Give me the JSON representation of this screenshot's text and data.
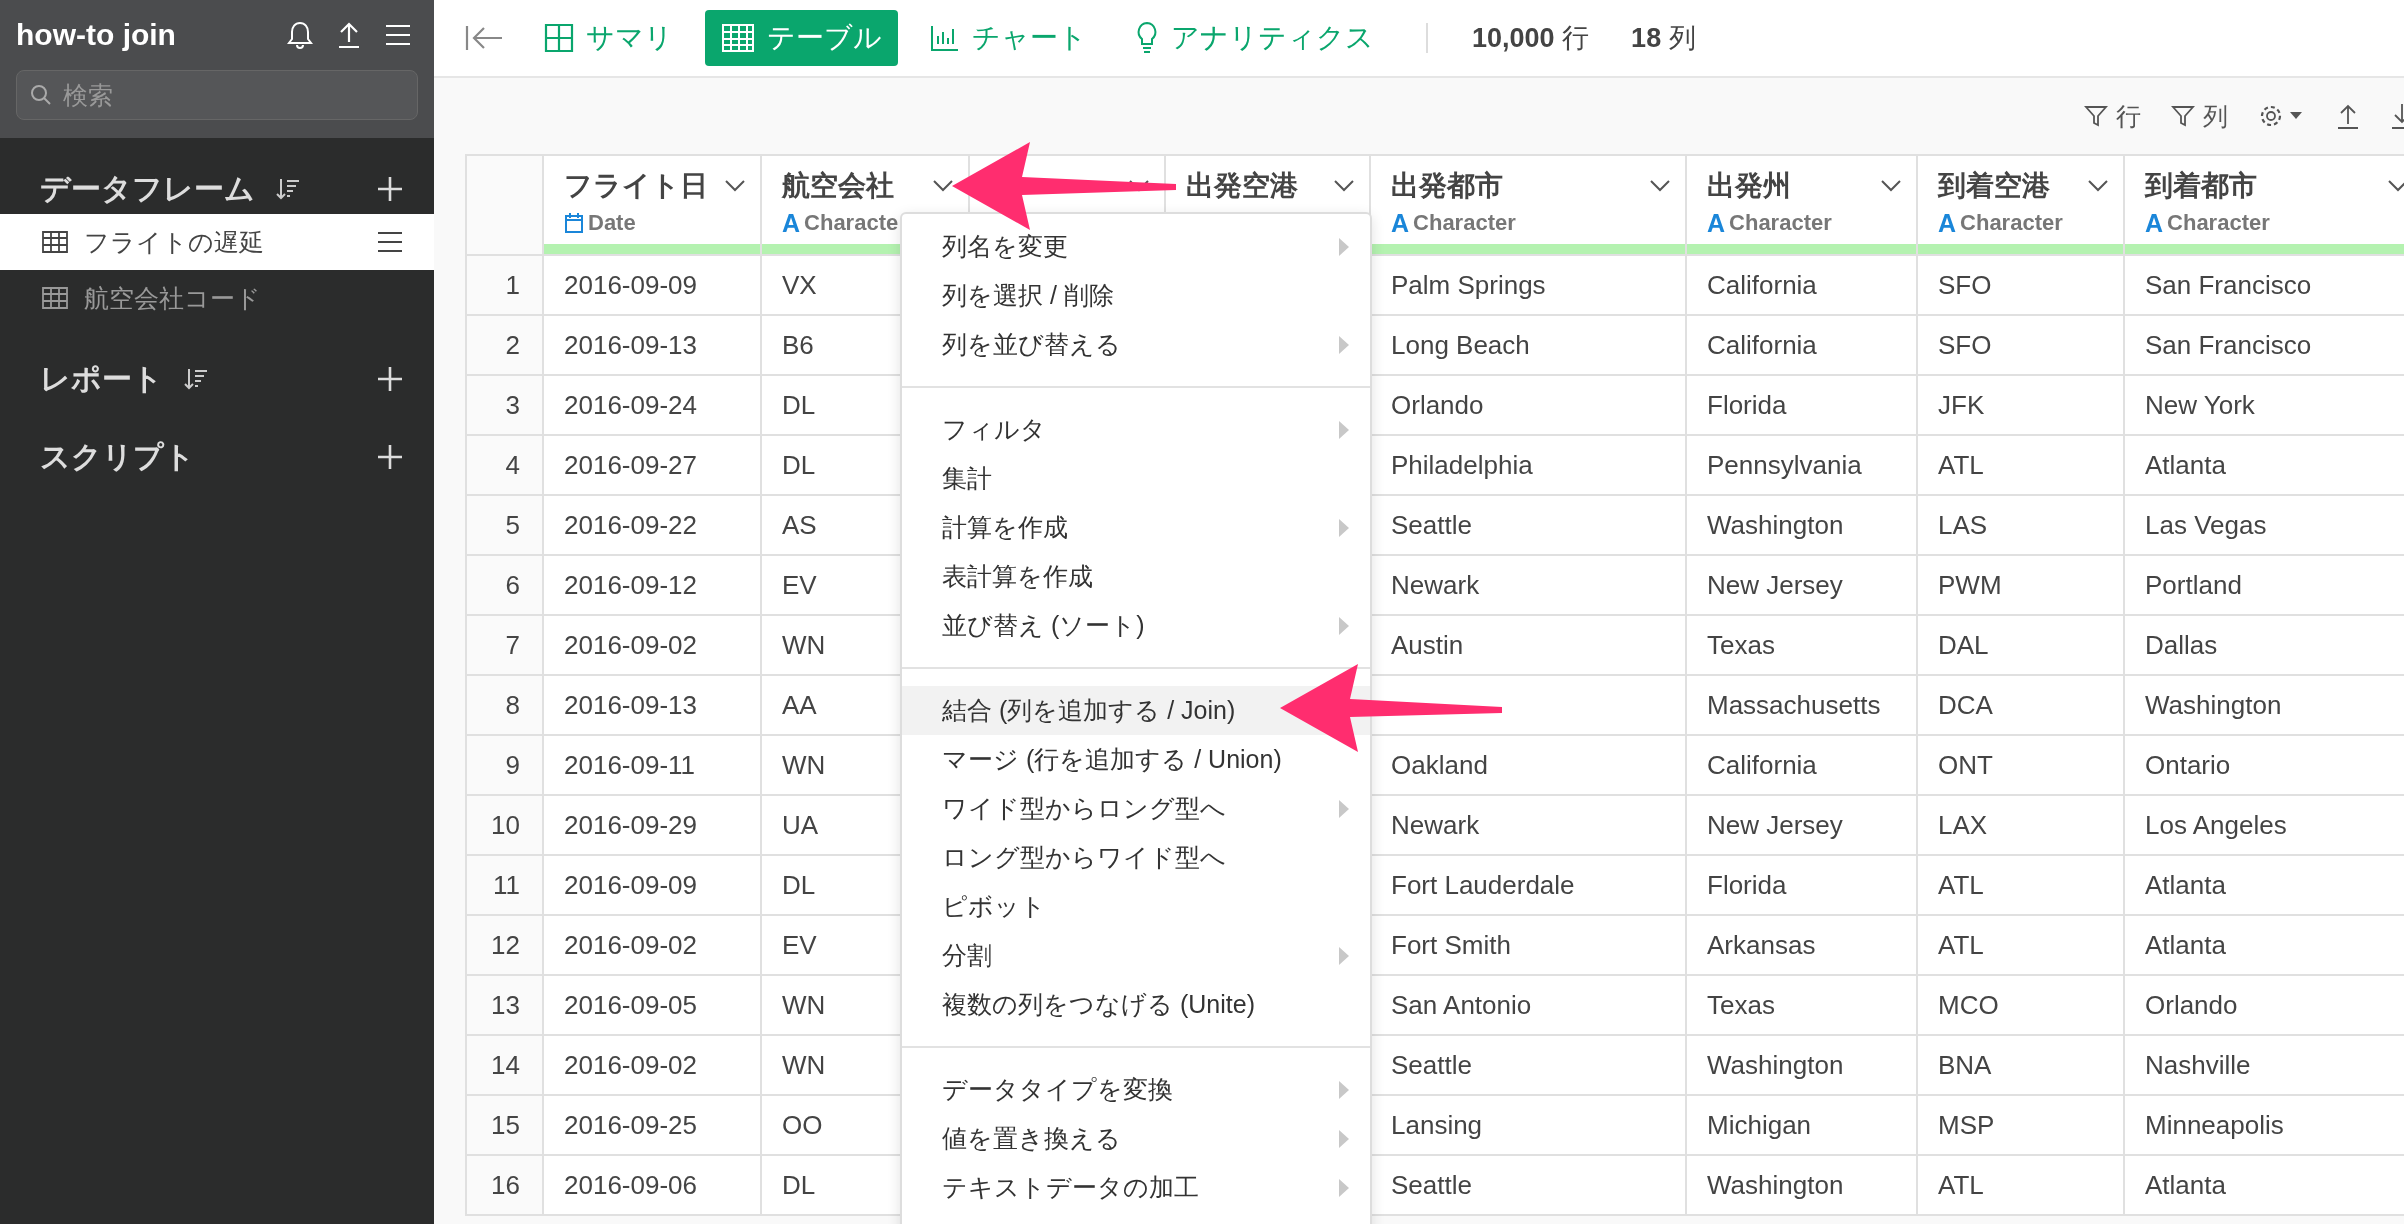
{
  "sidebar": {
    "title": "how-to join",
    "search": {
      "placeholder": "検索"
    },
    "sections": [
      {
        "title": "データフレーム",
        "sortable": true,
        "items": [
          {
            "label": "フライトの遅延",
            "selected": true
          },
          {
            "label": "航空会社コード",
            "selected": false
          }
        ]
      },
      {
        "title": "レポート",
        "sortable": true
      },
      {
        "title": "スクリプト",
        "sortable": false
      }
    ]
  },
  "tabs": [
    {
      "label": "サマリ",
      "kind": "summary",
      "selected": false
    },
    {
      "label": "テーブル",
      "kind": "table",
      "selected": true
    },
    {
      "label": "チャート",
      "kind": "chart",
      "selected": false
    },
    {
      "label": "アナリティクス",
      "kind": "analytics",
      "selected": false
    }
  ],
  "counts": [
    "**10,000** 行",
    "**18** 列"
  ],
  "toolbar": [
    {
      "kind": "filter",
      "label": "行"
    },
    {
      "kind": "filter",
      "label": "列"
    },
    {
      "kind": "settings"
    },
    {
      "kind": "upload"
    },
    {
      "kind": "download"
    }
  ],
  "table": {
    "columns": [
      {
        "name": "フライト日",
        "type": {
          "kind": "date",
          "label": "Date"
        }
      },
      {
        "name": "航空会社",
        "type": {
          "kind": "character",
          "icon": "A",
          "label": "Characte"
        }
      },
      {
        "caret": true
      },
      {
        "name": "出発空港"
      },
      {
        "name": "出発都市",
        "type": {
          "kind": "character",
          "icon": "A",
          "label": "Character"
        }
      },
      {
        "name": "出発州",
        "type": {
          "kind": "character",
          "icon": "A",
          "label": "Character"
        }
      },
      {
        "name": "到着空港",
        "type": {
          "kind": "character",
          "icon": "A",
          "label": "Character"
        }
      },
      {
        "name": "到着都市",
        "type": {
          "kind": "character",
          "icon": "A",
          "label": "Character"
        }
      }
    ],
    "rows": [
      {
        "num": "1",
        "cells": [
          "2016-09-09",
          "VX",
          null,
          null,
          "Palm Springs",
          "California",
          "SFO",
          "San Francisco"
        ]
      },
      {
        "num": "2",
        "cells": [
          "2016-09-13",
          "B6",
          null,
          null,
          "Long Beach",
          "California",
          "SFO",
          "San Francisco"
        ]
      },
      {
        "num": "3",
        "cells": [
          "2016-09-24",
          "DL",
          null,
          null,
          "Orlando",
          "Florida",
          "JFK",
          "New York"
        ]
      },
      {
        "num": "4",
        "cells": [
          "2016-09-27",
          "DL",
          null,
          null,
          "Philadelphia",
          "Pennsylvania",
          "ATL",
          "Atlanta"
        ]
      },
      {
        "num": "5",
        "cells": [
          "2016-09-22",
          "AS",
          null,
          null,
          "Seattle",
          "Washington",
          "LAS",
          "Las Vegas"
        ]
      },
      {
        "num": "6",
        "cells": [
          "2016-09-12",
          "EV",
          null,
          null,
          "Newark",
          "New Jersey",
          "PWM",
          "Portland"
        ]
      },
      {
        "num": "7",
        "cells": [
          "2016-09-02",
          "WN",
          null,
          null,
          "Austin",
          "Texas",
          "DAL",
          "Dallas"
        ]
      },
      {
        "num": "8",
        "cells": [
          "2016-09-13",
          "AA",
          null,
          null,
          null,
          "Massachusetts",
          "DCA",
          "Washington"
        ]
      },
      {
        "num": "9",
        "cells": [
          "2016-09-11",
          "WN",
          null,
          null,
          "Oakland",
          "California",
          "ONT",
          "Ontario"
        ]
      },
      {
        "num": "10",
        "cells": [
          "2016-09-29",
          "UA",
          null,
          null,
          "Newark",
          "New Jersey",
          "LAX",
          "Los Angeles"
        ]
      },
      {
        "num": "11",
        "cells": [
          "2016-09-09",
          "DL",
          null,
          null,
          "Fort Lauderdale",
          "Florida",
          "ATL",
          "Atlanta"
        ]
      },
      {
        "num": "12",
        "cells": [
          "2016-09-02",
          "EV",
          null,
          null,
          "Fort Smith",
          "Arkansas",
          "ATL",
          "Atlanta"
        ]
      },
      {
        "num": "13",
        "cells": [
          "2016-09-05",
          "WN",
          null,
          null,
          "San Antonio",
          "Texas",
          "MCO",
          "Orlando"
        ]
      },
      {
        "num": "14",
        "cells": [
          "2016-09-02",
          "WN",
          null,
          null,
          "Seattle",
          "Washington",
          "BNA",
          "Nashville"
        ]
      },
      {
        "num": "15",
        "cells": [
          "2016-09-25",
          "OO",
          null,
          null,
          "Lansing",
          "Michigan",
          "MSP",
          "Minneapolis"
        ]
      },
      {
        "num": "16",
        "cells": [
          "2016-09-06",
          "DL",
          null,
          null,
          "Seattle",
          "Washington",
          "ATL",
          "Atlanta"
        ]
      }
    ]
  },
  "column_menu": {
    "groups": [
      [
        {
          "label": "列名を変更",
          "submenu": true,
          "selected": false
        },
        {
          "label": "列を選択 / 削除",
          "submenu": false,
          "selected": false
        },
        {
          "label": "列を並び替える",
          "submenu": true,
          "selected": false
        }
      ],
      [
        {
          "label": "フィルタ",
          "submenu": true,
          "selected": false
        },
        {
          "label": "集計",
          "submenu": false,
          "selected": false
        },
        {
          "label": "計算を作成",
          "submenu": true,
          "selected": false
        },
        {
          "label": "表計算を作成",
          "submenu": false,
          "selected": false
        },
        {
          "label": "並び替え (ソート)",
          "submenu": true,
          "selected": false
        }
      ],
      [
        {
          "label": "結合 (列を追加する / Join)",
          "submenu": false,
          "selected": true
        },
        {
          "label": "マージ (行を追加する / Union)",
          "submenu": false,
          "selected": false
        },
        {
          "label": "ワイド型からロング型へ",
          "submenu": true,
          "selected": false
        },
        {
          "label": "ロング型からワイド型へ",
          "submenu": false,
          "selected": false
        },
        {
          "label": "ピボット",
          "submenu": false,
          "selected": false
        },
        {
          "label": "分割",
          "submenu": true,
          "selected": false
        },
        {
          "label": "複数の列をつなげる (Unite)",
          "submenu": false,
          "selected": false
        }
      ],
      [
        {
          "label": "データタイプを変換",
          "submenu": true,
          "selected": false
        },
        {
          "label": "値を置き換える",
          "submenu": true,
          "selected": false
        },
        {
          "label": "テキストデータの加工",
          "submenu": true,
          "selected": false
        }
      ]
    ]
  },
  "annotations": [
    {
      "kind": "arrow"
    },
    {
      "kind": "arrow"
    }
  ]
}
